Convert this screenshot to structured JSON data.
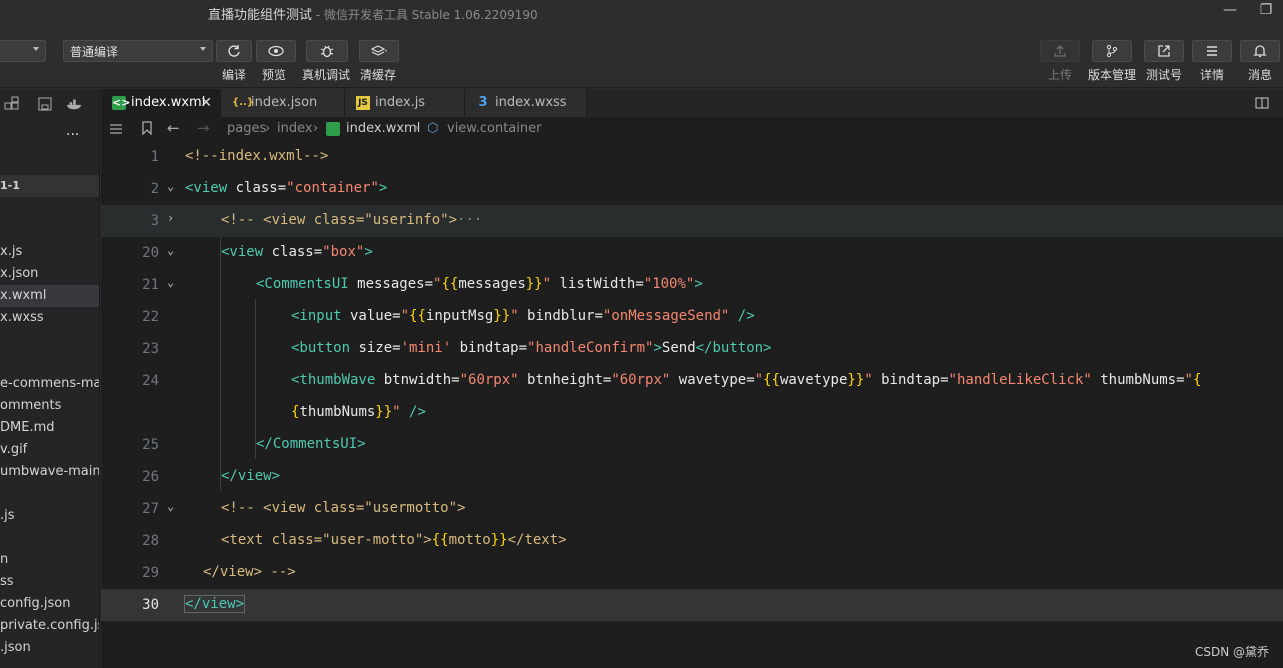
{
  "window": {
    "title": "直播功能组件测试",
    "subtitle": " - 微信开发者工具 Stable 1.06.2209190"
  },
  "toolbar": {
    "compile_mode": "普通编译",
    "buttons": [
      {
        "label": "编译",
        "icon": "refresh-icon"
      },
      {
        "label": "预览",
        "icon": "eye-icon"
      },
      {
        "label": "真机调试",
        "icon": "bug-icon"
      },
      {
        "label": "清缓存",
        "icon": "layers-icon"
      }
    ],
    "right_buttons": [
      {
        "label": "上传",
        "icon": "upload-icon",
        "disabled": true
      },
      {
        "label": "版本管理",
        "icon": "branch-icon"
      },
      {
        "label": "测试号",
        "icon": "external-link-icon"
      },
      {
        "label": "详情",
        "icon": "menu-icon"
      },
      {
        "label": "消息",
        "icon": "bell-icon"
      }
    ]
  },
  "explorer": {
    "more": "...",
    "items": [
      {
        "label": "1-1",
        "kind": "header"
      },
      {
        "label": "x.js"
      },
      {
        "label": "x.json"
      },
      {
        "label": "x.wxml",
        "selected": true
      },
      {
        "label": "x.wxss"
      },
      {
        "label": "e-commens-ma..."
      },
      {
        "label": "omments"
      },
      {
        "label": "DME.md"
      },
      {
        "label": "v.gif"
      },
      {
        "label": "umbwave-main"
      },
      {
        "label": ".js"
      },
      {
        "label": "n"
      },
      {
        "label": "ss"
      },
      {
        "label": "config.json"
      },
      {
        "label": "private.config.js..."
      },
      {
        "label": ".json"
      }
    ]
  },
  "tabs": [
    {
      "label": "index.wxml",
      "icon": "wxml-file-icon",
      "active": true,
      "close": "✕"
    },
    {
      "label": "index.json",
      "icon": "json-file-icon"
    },
    {
      "label": "index.js",
      "icon": "js-file-icon"
    },
    {
      "label": "index.wxss",
      "icon": "css-file-icon"
    }
  ],
  "breadcrumb": {
    "parts": [
      "pages",
      "index",
      "index.wxml",
      "view.container"
    ]
  },
  "editor": {
    "lines": [
      {
        "num": "1"
      },
      {
        "num": "2"
      },
      {
        "num": "3"
      },
      {
        "num": "20"
      },
      {
        "num": "21"
      },
      {
        "num": "22"
      },
      {
        "num": "23"
      },
      {
        "num": "24"
      },
      {
        "num": ""
      },
      {
        "num": "25"
      },
      {
        "num": "26"
      },
      {
        "num": "27"
      },
      {
        "num": "28"
      },
      {
        "num": "29"
      },
      {
        "num": "30"
      }
    ],
    "code": {
      "l1": "<!--index.wxml-->",
      "l2a": "<view",
      "l2b": " class=",
      "l2c": "\"container\"",
      "l2d": ">",
      "l3a": "<!-- <view class=\"userinfo\">",
      "l3b": "···",
      "l20a": "<view",
      "l20b": " class=",
      "l20c": "\"box\"",
      "l20d": ">",
      "l21a": "<CommentsUI",
      "l21b": " messages=",
      "l21c": "\"",
      "l21d": "{{",
      "l21e": "messages",
      "l21f": "}}",
      "l21g": "\"",
      "l21h": " listWidth=",
      "l21i": "\"100%\"",
      "l21j": ">",
      "l22a": "<input",
      "l22b": " value=",
      "l22c": "\"",
      "l22d": "{{",
      "l22e": "inputMsg",
      "l22f": "}}",
      "l22g": "\"",
      "l22h": " bindblur=",
      "l22i": "\"onMessageSend\"",
      "l22j": " />",
      "l23a": "<button",
      "l23b": " size=",
      "l23c": "'mini'",
      "l23d": " bindtap=",
      "l23e": "\"handleConfirm\"",
      "l23f": ">",
      "l23g": "Send",
      "l23h": "</button>",
      "l24a": "<thumbWave",
      "l24b": " btnwidth=",
      "l24c": "\"60rpx\"",
      "l24d": " btnheight=",
      "l24e": "\"60rpx\"",
      "l24f": " wavetype=",
      "l24g": "\"",
      "l24h": "{{",
      "l24i": "wavetype",
      "l24j": "}}",
      "l24k": "\"",
      "l24l": " bindtap=",
      "l24m": "\"handleLikeClick\"",
      "l24n": " thumbNums=",
      "l24o": "\"",
      "l24p": "{",
      "l24q": "{",
      "l24r": "thumbNums",
      "l24s": "}}",
      "l24t": "\"",
      "l24u": " />",
      "l25": "</CommentsUI>",
      "l26": "</view>",
      "l27": "<!-- <view class=\"usermotto\">",
      "l28a": "<text class=\"user-motto\">",
      "l28b": "{{",
      "l28c": "motto",
      "l28d": "}}",
      "l28e": "</text>",
      "l29": "</view> -->",
      "l30": "</view>"
    }
  },
  "watermark": "CSDN @黛乔",
  "colors": {
    "background": "#1e1e1e",
    "tag": "#4ec9b0",
    "string": "#f48771",
    "comment": "#d7ba7d",
    "brace": "#ffd700"
  }
}
